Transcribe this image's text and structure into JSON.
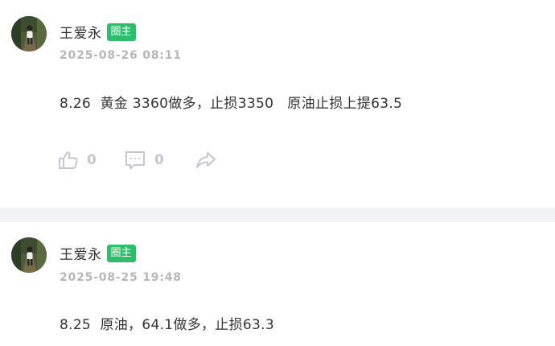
{
  "posts": [
    {
      "author": "王爱永",
      "badge": "圈主",
      "timestamp": "2025-08-26 08:11",
      "content": "8.26  黄金 3360做多，止损3350   原油止损上提63.5",
      "likes": "0",
      "comments": "0"
    },
    {
      "author": "王爱永",
      "badge": "圈主",
      "timestamp": "2025-08-25 19:48",
      "content": "8.25  原油，64.1做多，止损63.3"
    }
  ],
  "colors": {
    "badge": "#2ebd6b",
    "divider": "#f2f3f7",
    "icon": "#c4c7d3",
    "timestamp": "#b7b7b7"
  },
  "icons": [
    "thumbs-up-icon",
    "comment-icon",
    "share-icon"
  ]
}
